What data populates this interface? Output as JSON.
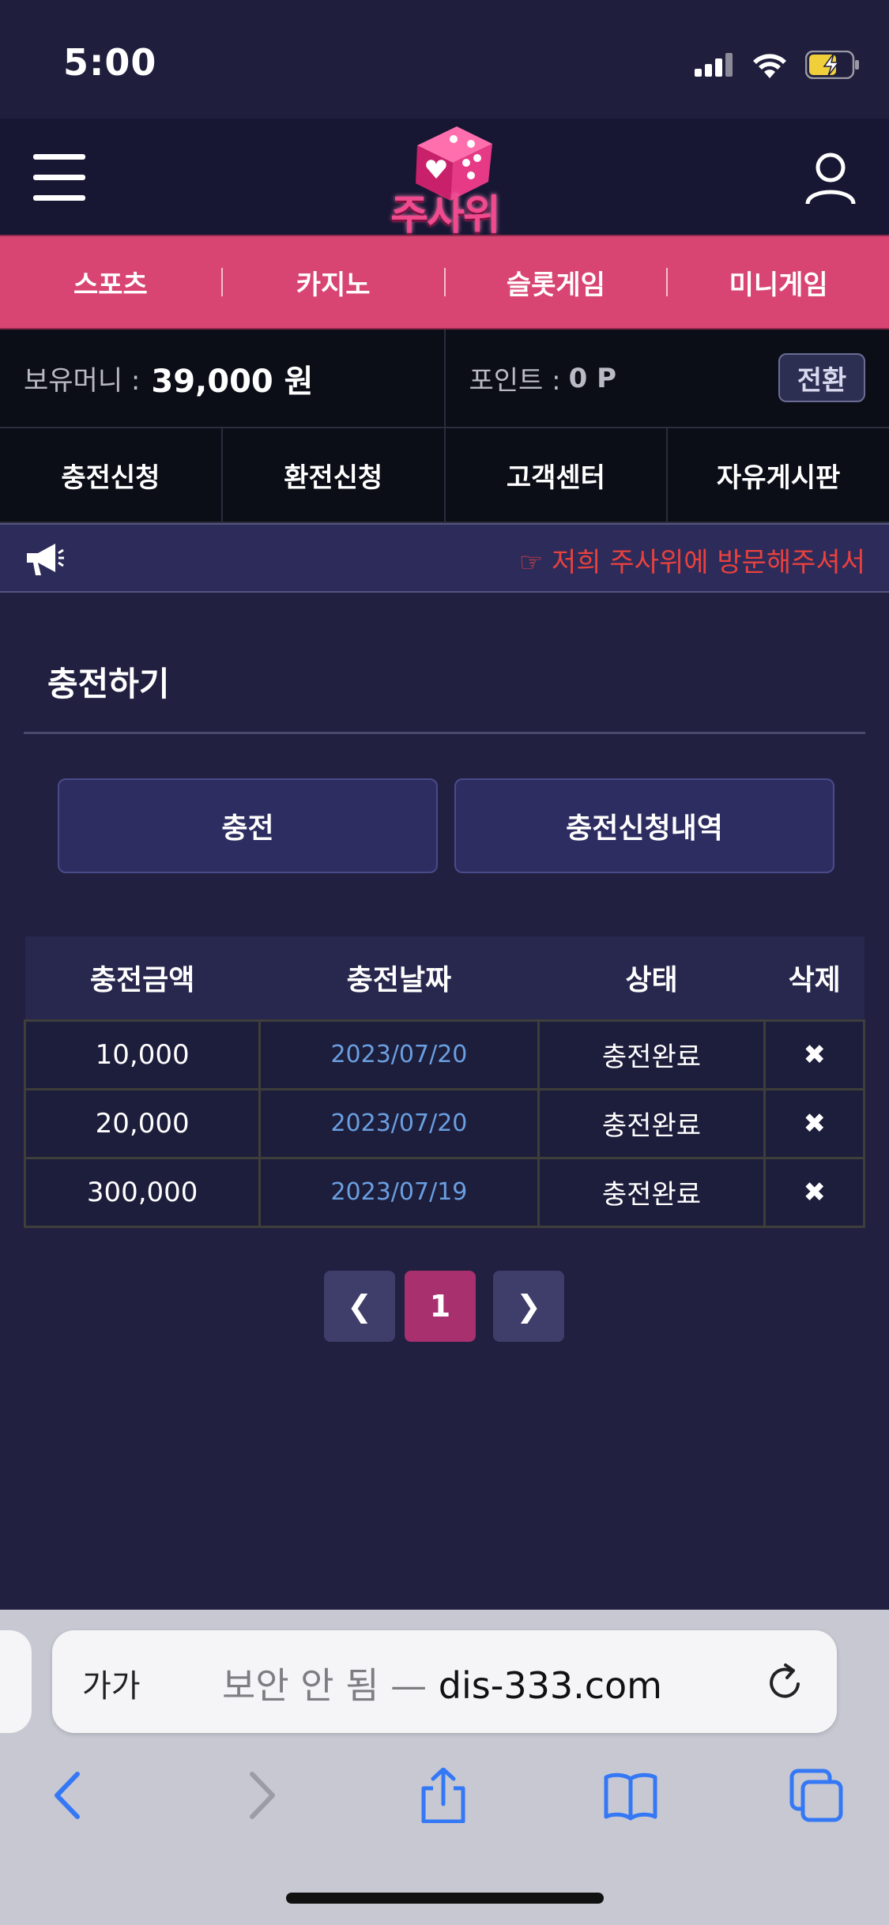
{
  "status_bar": {
    "time": "5:00",
    "battery_color": "#f0cf3a"
  },
  "header": {
    "logo_text": "주사위"
  },
  "game_nav": {
    "items": [
      "스포츠",
      "카지노",
      "슬롯게임",
      "미니게임"
    ]
  },
  "balance": {
    "money_label": "보유머니 :",
    "money_value": "39,000 원",
    "point_label": "포인트 :",
    "point_value": "0 P",
    "convert_label": "전환"
  },
  "action_nav": {
    "items": [
      "충전신청",
      "환전신청",
      "고객센터",
      "자유게시판"
    ]
  },
  "notice": {
    "text": "☞ 저희 주사위에 방문해주셔서"
  },
  "content": {
    "title": "충전하기",
    "tabs": [
      "충전",
      "충전신청내역"
    ]
  },
  "table": {
    "headers": [
      "충전금액",
      "충전날짜",
      "상태",
      "삭제"
    ],
    "rows": [
      {
        "amount": "10,000",
        "date": "2023/07/20",
        "status": "충전완료",
        "delete": "✖"
      },
      {
        "amount": "20,000",
        "date": "2023/07/20",
        "status": "충전완료",
        "delete": "✖"
      },
      {
        "amount": "300,000",
        "date": "2023/07/19",
        "status": "충전완료",
        "delete": "✖"
      }
    ]
  },
  "pagination": {
    "current_page": "1",
    "prev": "❮",
    "next": "❯"
  },
  "browser": {
    "aa_label": "가가",
    "insecure_label": "보안 안 됨 —",
    "domain": "dis-333.com"
  },
  "colors": {
    "accent_pink": "#d94572",
    "active_page": "#a8306f",
    "background": "#212040",
    "notice_text": "#e8413e",
    "date_text": "#6a9fe0"
  }
}
